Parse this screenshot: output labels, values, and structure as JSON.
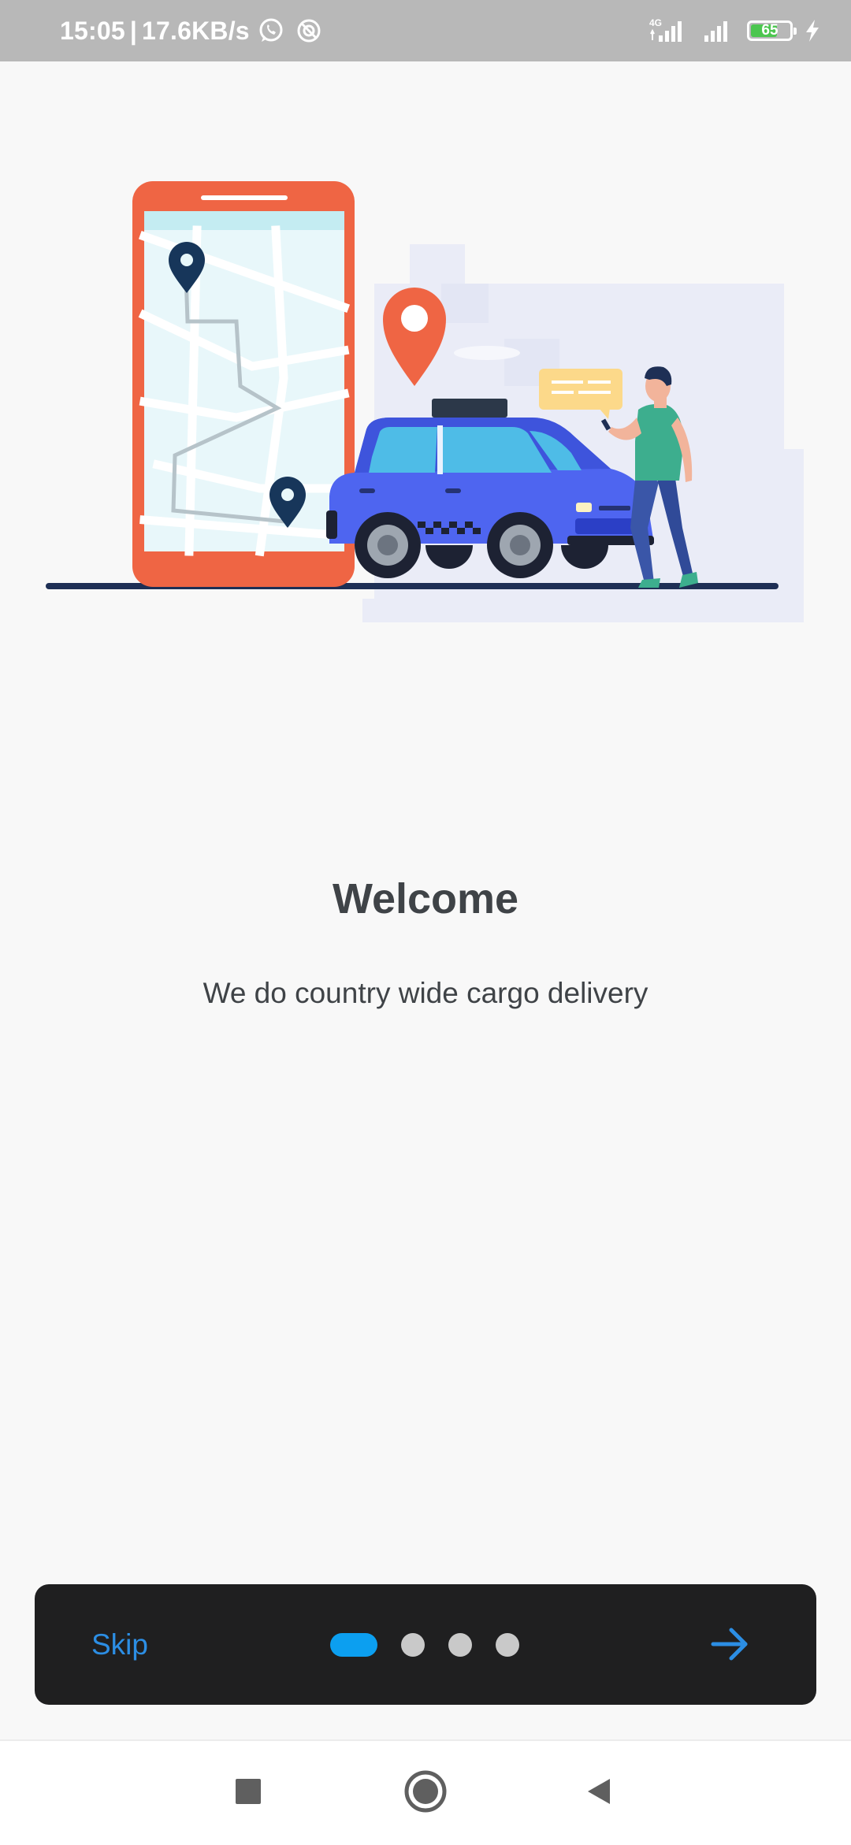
{
  "status_bar": {
    "time": "15:05",
    "separator": "|",
    "network_speed": "17.6KB/s",
    "battery_level": "65",
    "network_type": "4G",
    "icons": [
      "whatsapp-icon",
      "sync-off-icon",
      "signal-4g-icon",
      "signal-icon",
      "battery-icon",
      "charging-icon"
    ]
  },
  "onboarding": {
    "title": "Welcome",
    "subtitle": "We do country wide cargo delivery",
    "illustration": "taxi-map-illustration"
  },
  "bottom_bar": {
    "skip_label": "Skip",
    "page_count": 4,
    "active_page": 1,
    "next_icon": "arrow-right-icon"
  },
  "nav_bar": {
    "icons": [
      "recents-icon",
      "home-icon",
      "back-icon"
    ]
  },
  "colors": {
    "accent": "#0c9ff0",
    "skip_text": "#2c8ee4",
    "card_background": "#1f1f20",
    "page_background": "#f8f8f8",
    "title_text": "#3f4347",
    "status_bar": "#b8b8b8"
  }
}
